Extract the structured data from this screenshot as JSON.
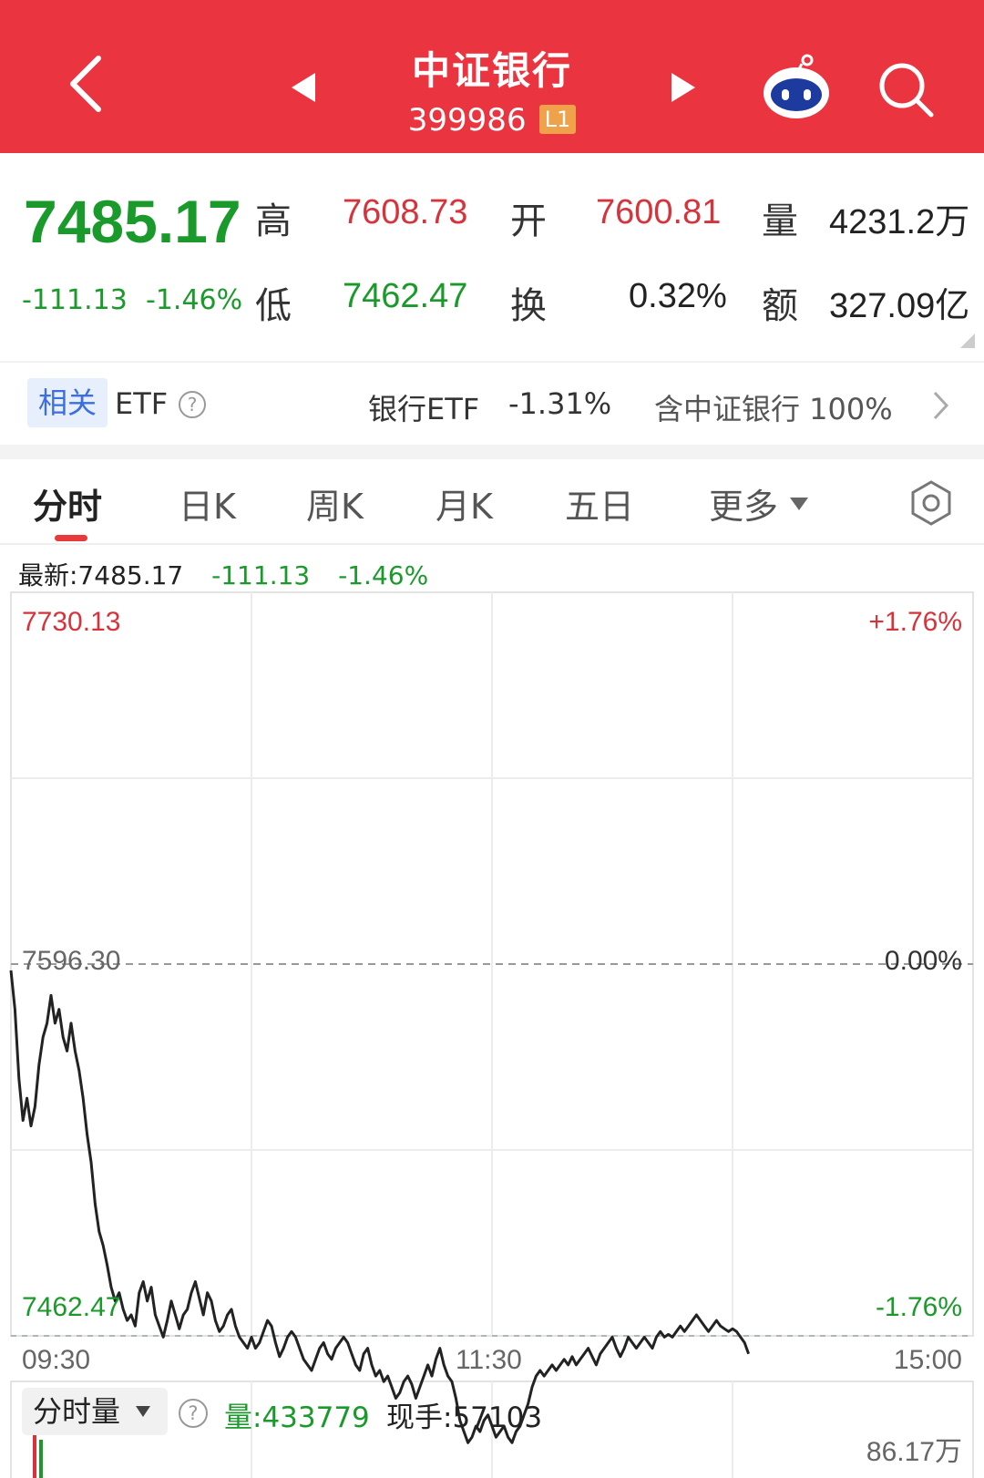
{
  "header": {
    "title": "中证银行",
    "code": "399986",
    "level_badge": "L1",
    "bg_color": "#ea3540",
    "icons": [
      "back-arrow-icon",
      "prev-arrow-icon",
      "next-arrow-icon",
      "robot-assistant-icon",
      "search-icon"
    ]
  },
  "quote": {
    "last": "7485.17",
    "change": "-111.13",
    "change_pct": "-1.46%",
    "high_label": "高",
    "high": "7608.73",
    "open_label": "开",
    "open": "7600.81",
    "volume_label": "量",
    "volume": "4231.2万",
    "low_label": "低",
    "low": "7462.47",
    "turnover_label": "换",
    "turnover": "0.32%",
    "amount_label": "额",
    "amount": "327.09亿"
  },
  "etf": {
    "tag": "相关",
    "label": "ETF",
    "name": "银行ETF",
    "change": "-1.31%",
    "holding": "含中证银行 100%"
  },
  "tabs": [
    "分时",
    "日K",
    "周K",
    "月K",
    "五日",
    "更多"
  ],
  "chart_data": {
    "type": "line",
    "info": {
      "label": "最新:7485.17",
      "change": "-111.13",
      "pct": "-1.46%"
    },
    "y_top_label": "7730.13",
    "y_mid_label": "7596.30",
    "y_bottom_label": "7462.47",
    "pct_top": "+1.76%",
    "pct_mid": "0.00%",
    "pct_bottom": "-1.76%",
    "ylim": [
      7462.47,
      7730.13
    ],
    "prev_close": 7596.3,
    "x_labels": [
      "09:30",
      "11:30",
      "15:00"
    ],
    "x_range": [
      0,
      240
    ],
    "points": [
      [
        0,
        7594
      ],
      [
        1,
        7580
      ],
      [
        2,
        7555
      ],
      [
        3,
        7540
      ],
      [
        4,
        7548
      ],
      [
        5,
        7538
      ],
      [
        6,
        7545
      ],
      [
        7,
        7560
      ],
      [
        8,
        7570
      ],
      [
        9,
        7575
      ],
      [
        10,
        7585
      ],
      [
        11,
        7575
      ],
      [
        12,
        7580
      ],
      [
        13,
        7570
      ],
      [
        14,
        7565
      ],
      [
        15,
        7575
      ],
      [
        16,
        7565
      ],
      [
        17,
        7558
      ],
      [
        18,
        7548
      ],
      [
        19,
        7535
      ],
      [
        20,
        7525
      ],
      [
        21,
        7510
      ],
      [
        22,
        7500
      ],
      [
        23,
        7495
      ],
      [
        24,
        7488
      ],
      [
        25,
        7480
      ],
      [
        26,
        7475
      ],
      [
        27,
        7478
      ],
      [
        28,
        7472
      ],
      [
        29,
        7468
      ],
      [
        30,
        7470
      ],
      [
        31,
        7466
      ],
      [
        32,
        7478
      ],
      [
        33,
        7482
      ],
      [
        34,
        7475
      ],
      [
        35,
        7480
      ],
      [
        36,
        7470
      ],
      [
        37,
        7466
      ],
      [
        38,
        7462
      ],
      [
        39,
        7468
      ],
      [
        40,
        7475
      ],
      [
        41,
        7470
      ],
      [
        42,
        7465
      ],
      [
        43,
        7470
      ],
      [
        44,
        7472
      ],
      [
        45,
        7478
      ],
      [
        46,
        7482
      ],
      [
        47,
        7476
      ],
      [
        48,
        7470
      ],
      [
        49,
        7478
      ],
      [
        50,
        7475
      ],
      [
        51,
        7468
      ],
      [
        52,
        7464
      ],
      [
        53,
        7466
      ],
      [
        54,
        7470
      ],
      [
        55,
        7472
      ],
      [
        56,
        7466
      ],
      [
        57,
        7462
      ],
      [
        58,
        7460
      ],
      [
        59,
        7458
      ],
      [
        60,
        7462
      ],
      [
        61,
        7458
      ],
      [
        62,
        7460
      ],
      [
        63,
        7464
      ],
      [
        64,
        7468
      ],
      [
        65,
        7466
      ],
      [
        66,
        7460
      ],
      [
        67,
        7455
      ],
      [
        68,
        7458
      ],
      [
        69,
        7462
      ],
      [
        70,
        7464
      ],
      [
        71,
        7462
      ],
      [
        72,
        7458
      ],
      [
        73,
        7454
      ],
      [
        74,
        7452
      ],
      [
        75,
        7450
      ],
      [
        76,
        7454
      ],
      [
        77,
        7458
      ],
      [
        78,
        7460
      ],
      [
        79,
        7456
      ],
      [
        80,
        7454
      ],
      [
        81,
        7458
      ],
      [
        82,
        7460
      ],
      [
        83,
        7462
      ],
      [
        84,
        7460
      ],
      [
        85,
        7456
      ],
      [
        86,
        7452
      ],
      [
        87,
        7450
      ],
      [
        88,
        7456
      ],
      [
        89,
        7458
      ],
      [
        90,
        7452
      ],
      [
        91,
        7448
      ],
      [
        92,
        7450
      ],
      [
        93,
        7446
      ],
      [
        94,
        7448
      ],
      [
        95,
        7444
      ],
      [
        96,
        7440
      ],
      [
        97,
        7442
      ],
      [
        98,
        7446
      ],
      [
        99,
        7448
      ],
      [
        100,
        7445
      ],
      [
        101,
        7440
      ],
      [
        102,
        7444
      ],
      [
        103,
        7448
      ],
      [
        104,
        7452
      ],
      [
        105,
        7448
      ],
      [
        106,
        7454
      ],
      [
        107,
        7458
      ],
      [
        108,
        7452
      ],
      [
        109,
        7448
      ],
      [
        110,
        7446
      ],
      [
        111,
        7440
      ],
      [
        112,
        7432
      ],
      [
        113,
        7428
      ],
      [
        114,
        7424
      ],
      [
        115,
        7426
      ],
      [
        116,
        7430
      ],
      [
        117,
        7428
      ],
      [
        118,
        7432
      ],
      [
        119,
        7434
      ],
      [
        120,
        7430
      ],
      [
        121,
        7426
      ],
      [
        122,
        7428
      ],
      [
        123,
        7430
      ],
      [
        124,
        7426
      ],
      [
        125,
        7424
      ],
      [
        126,
        7428
      ],
      [
        127,
        7430
      ],
      [
        128,
        7434
      ],
      [
        129,
        7438
      ],
      [
        130,
        7444
      ],
      [
        131,
        7448
      ],
      [
        132,
        7450
      ],
      [
        133,
        7448
      ],
      [
        134,
        7450
      ],
      [
        135,
        7452
      ],
      [
        136,
        7450
      ],
      [
        137,
        7452
      ],
      [
        138,
        7454
      ],
      [
        139,
        7452
      ],
      [
        140,
        7455
      ],
      [
        141,
        7452
      ],
      [
        142,
        7454
      ],
      [
        143,
        7456
      ],
      [
        144,
        7458
      ],
      [
        145,
        7455
      ],
      [
        146,
        7452
      ],
      [
        147,
        7456
      ],
      [
        148,
        7458
      ],
      [
        149,
        7460
      ],
      [
        150,
        7462
      ],
      [
        151,
        7458
      ],
      [
        152,
        7455
      ],
      [
        153,
        7458
      ],
      [
        154,
        7462
      ],
      [
        155,
        7460
      ],
      [
        156,
        7458
      ],
      [
        157,
        7460
      ],
      [
        158,
        7462
      ],
      [
        159,
        7460
      ],
      [
        160,
        7458
      ],
      [
        161,
        7462
      ],
      [
        162,
        7464
      ],
      [
        163,
        7462
      ],
      [
        164,
        7463
      ],
      [
        165,
        7462
      ],
      [
        166,
        7464
      ],
      [
        167,
        7466
      ],
      [
        168,
        7464
      ],
      [
        169,
        7466
      ],
      [
        170,
        7468
      ],
      [
        171,
        7470
      ],
      [
        172,
        7468
      ],
      [
        173,
        7466
      ],
      [
        174,
        7464
      ],
      [
        175,
        7466
      ],
      [
        176,
        7468
      ],
      [
        177,
        7466
      ],
      [
        178,
        7465
      ],
      [
        179,
        7464
      ],
      [
        180,
        7465
      ],
      [
        181,
        7464
      ],
      [
        182,
        7462
      ],
      [
        183,
        7460
      ],
      [
        184,
        7456
      ]
    ],
    "volume_selector": "分时量",
    "volume_label": "量:433779",
    "hand_label": "现手:57103",
    "volume_max_label": "86.17万"
  },
  "colors": {
    "up": "#d6333b",
    "down": "#1a9a2a",
    "accent": "#ea3540"
  }
}
